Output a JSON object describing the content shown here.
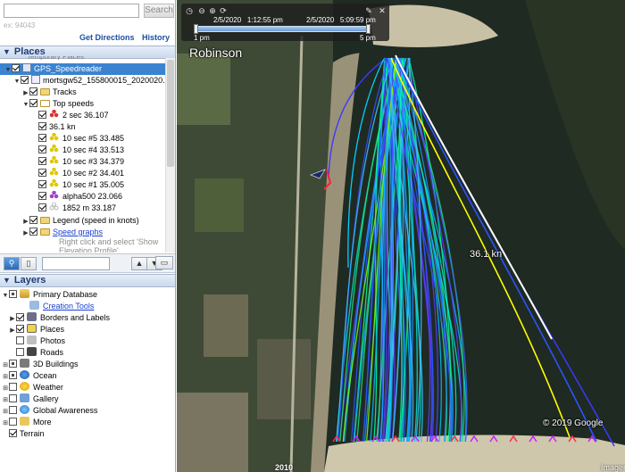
{
  "search": {
    "value": "",
    "placeholder": "",
    "button_label": "Search",
    "hint": "ex: 94043"
  },
  "directions": {
    "get_directions": "Get Directions",
    "history": "History"
  },
  "places": {
    "header": "Places",
    "cut_item": "Temporary Places",
    "items": [
      {
        "label": "GPS_Speedreader"
      },
      {
        "label": "mortsgw52_155800015_2020020..."
      },
      {
        "label": "Tracks"
      },
      {
        "label": "Top speeds"
      },
      {
        "label": "2 sec 36.107"
      },
      {
        "label": "36.1 kn"
      },
      {
        "label": "10 sec #5 33.485"
      },
      {
        "label": "10 sec #4 33.513"
      },
      {
        "label": "10 sec #3 34.379"
      },
      {
        "label": "10 sec #2 34.401"
      },
      {
        "label": "10 sec #1 35.005"
      },
      {
        "label": "alpha500 23.066"
      },
      {
        "label": "1852 m 33.187"
      },
      {
        "label": "Legend (speed in knots)"
      },
      {
        "label": "Speed graphs"
      },
      {
        "label": "Right click and select 'Show"
      },
      {
        "label": "Elevation Profile'"
      }
    ]
  },
  "layers": {
    "header": "Layers",
    "items": [
      {
        "label": "Primary Database"
      },
      {
        "label": "Creation Tools"
      },
      {
        "label": "Borders and Labels"
      },
      {
        "label": "Places"
      },
      {
        "label": "Photos"
      },
      {
        "label": "Roads"
      },
      {
        "label": "3D Buildings"
      },
      {
        "label": "Ocean"
      },
      {
        "label": "Weather"
      },
      {
        "label": "Gallery"
      },
      {
        "label": "Global Awareness"
      },
      {
        "label": "More"
      },
      {
        "label": "Terrain"
      }
    ]
  },
  "map": {
    "time_slider": {
      "start_date": "2/5/2020",
      "start_time": "1:12:55 pm",
      "end_date": "2/5/2020",
      "end_time": "5:09:59 pm",
      "start_label": "1 pm",
      "end_label": "5 pm"
    },
    "place_label": "Robinson",
    "speed_label": "36.1 kn",
    "copyright": "© 2019 Google",
    "imagery": "Imager",
    "year": "2010"
  },
  "colors": {
    "selection": "#3b83d0",
    "header_text": "#1d3d75",
    "link": "#1a3fd0",
    "water": "#1f2a22",
    "sand": "#c9c1a6"
  }
}
